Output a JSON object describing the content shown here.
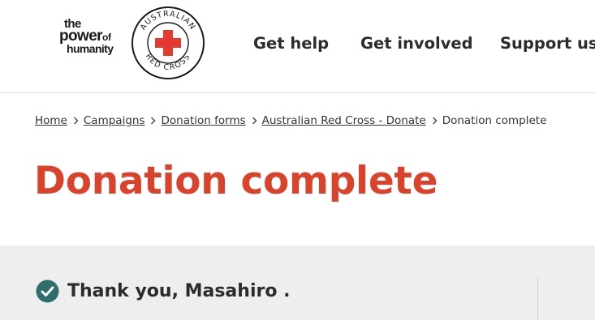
{
  "brand": {
    "tagline_line1": "the",
    "tagline_line2": "power",
    "tagline_line2_small": "of",
    "tagline_line3": "humanity",
    "emblem_top": "AUSTRALIAN",
    "emblem_bottom": "RED CROSS",
    "colors": {
      "red": "#e53a2f",
      "accent": "#d9432b"
    }
  },
  "nav": {
    "items": [
      {
        "label": "Get help"
      },
      {
        "label": "Get involved"
      },
      {
        "label": "Support us"
      }
    ]
  },
  "breadcrumb": {
    "items": [
      {
        "label": "Home"
      },
      {
        "label": "Campaigns"
      },
      {
        "label": "Donation forms"
      },
      {
        "label": "Australian Red Cross - Donate"
      }
    ],
    "current": "Donation complete"
  },
  "page": {
    "title": "Donation complete"
  },
  "confirmation": {
    "icon": "check-circle-icon",
    "icon_color": "#2f6e6a",
    "message": "Thank you, Masahiro ."
  }
}
